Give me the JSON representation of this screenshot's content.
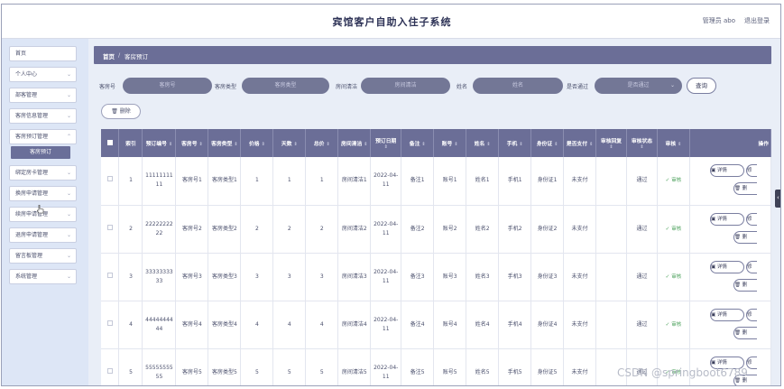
{
  "header": {
    "title": "宾馆客户自助入住子系统",
    "user": "管理员 abo",
    "logout": "退出登录"
  },
  "sidebar": {
    "items": [
      {
        "label": "首页",
        "has_chevron": false
      },
      {
        "label": "个人中心",
        "has_chevron": true
      },
      {
        "label": "部客管理",
        "has_chevron": true
      },
      {
        "label": "客房信息管理",
        "has_chevron": true
      },
      {
        "label": "客房预订管理",
        "has_chevron": true
      },
      {
        "label": "绑定房卡管理",
        "has_chevron": true
      },
      {
        "label": "换房申请管理",
        "has_chevron": true
      },
      {
        "label": "续房申请管理",
        "has_chevron": true
      },
      {
        "label": "退房申请管理",
        "has_chevron": true
      },
      {
        "label": "留言板管理",
        "has_chevron": true
      },
      {
        "label": "系统管理",
        "has_chevron": true
      }
    ],
    "active_sub": "客房预订"
  },
  "breadcrumb": {
    "home": "首页",
    "separator": "/",
    "current": "客房预订"
  },
  "search": {
    "room_no_label": "客房号",
    "room_no_placeholder": "客房号",
    "room_type_label": "客房类型",
    "room_type_placeholder": "客房类型",
    "clean_label": "房间清洁",
    "clean_placeholder": "房间清洁",
    "name_label": "姓名",
    "name_placeholder": "姓名",
    "passed_label": "是否通过",
    "passed_placeholder": "是否通过",
    "query_button": "查询"
  },
  "actions": {
    "delete_button": "删除"
  },
  "table": {
    "headers": [
      "索引",
      "预订编号",
      "客房号",
      "客房类型",
      "价格",
      "天数",
      "总价",
      "房间清洁",
      "预订日期",
      "备注",
      "账号",
      "姓名",
      "手机",
      "身份证",
      "是否支付",
      "审核回复",
      "审核状态",
      "审核",
      "操作"
    ],
    "rows": [
      {
        "index": "1",
        "order_no": "1111111111",
        "room_no": "客房号1",
        "room_type": "客房类型1",
        "price": "1",
        "days": "1",
        "total": "1",
        "clean": "房间清洁1",
        "date": "2022-04-11",
        "note": "备注1",
        "account": "账号1",
        "name": "姓名1",
        "phone": "手机1",
        "id_card": "身份证1",
        "paid": "未支付",
        "reply": "",
        "status": "通过",
        "audit": "审核"
      },
      {
        "index": "2",
        "order_no": "2222222222",
        "room_no": "客房号2",
        "room_type": "客房类型2",
        "price": "2",
        "days": "2",
        "total": "2",
        "clean": "房间清洁2",
        "date": "2022-04-11",
        "note": "备注2",
        "account": "账号2",
        "name": "姓名2",
        "phone": "手机2",
        "id_card": "身份证2",
        "paid": "未支付",
        "reply": "",
        "status": "通过",
        "audit": "审核"
      },
      {
        "index": "3",
        "order_no": "3333333333",
        "room_no": "客房号3",
        "room_type": "客房类型3",
        "price": "3",
        "days": "3",
        "total": "3",
        "clean": "房间清洁3",
        "date": "2022-04-11",
        "note": "备注3",
        "account": "账号3",
        "name": "姓名3",
        "phone": "手机3",
        "id_card": "身份证3",
        "paid": "未支付",
        "reply": "",
        "status": "通过",
        "audit": "审核"
      },
      {
        "index": "4",
        "order_no": "4444444444",
        "room_no": "客房号4",
        "room_type": "客房类型4",
        "price": "4",
        "days": "4",
        "total": "4",
        "clean": "房间清洁4",
        "date": "2022-04-11",
        "note": "备注4",
        "account": "账号4",
        "name": "姓名4",
        "phone": "手机4",
        "id_card": "身份证4",
        "paid": "未支付",
        "reply": "",
        "status": "通过",
        "audit": "审核"
      },
      {
        "index": "5",
        "order_no": "5555555555",
        "room_no": "客房号5",
        "room_type": "客房类型5",
        "price": "5",
        "days": "5",
        "total": "5",
        "clean": "房间清洁5",
        "date": "2022-04-11",
        "note": "备注5",
        "account": "账号5",
        "name": "姓名5",
        "phone": "手机5",
        "id_card": "身份证5",
        "paid": "未支付",
        "reply": "",
        "status": "通过",
        "audit": "审核"
      }
    ],
    "op_detail": "详情",
    "op_edit": "修",
    "op_delete": "删"
  },
  "watermark": "CSDN @springboot6789",
  "icons": {
    "chevron": "chevron-down-icon",
    "delete": "trash-icon",
    "detail": "doc-icon",
    "audit": "check-icon",
    "sort": "sort-icon",
    "side_toggle": "chevron-left-icon"
  },
  "colors": {
    "accent": "#6b6e97",
    "input_bg": "#737796",
    "sidebar_bg": "#dde6f6",
    "audit_green": "#4aa05a"
  }
}
